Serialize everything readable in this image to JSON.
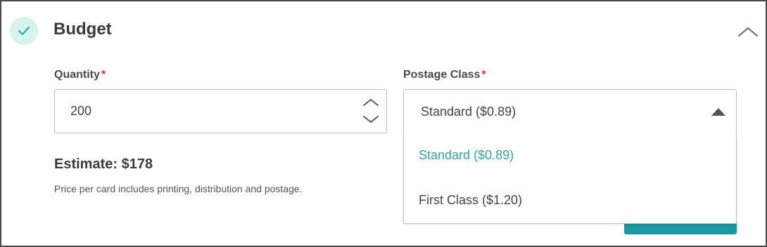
{
  "section": {
    "title": "Budget",
    "status_icon": "check-icon",
    "collapse_icon": "chevron-up-icon"
  },
  "quantity": {
    "label": "Quantity",
    "required_mark": "*",
    "value": "200",
    "stepper_up_icon": "chevron-up-icon",
    "stepper_down_icon": "chevron-down-icon"
  },
  "postage": {
    "label": "Postage Class",
    "required_mark": "*",
    "selected": "Standard ($0.89)",
    "caret_icon": "triangle-up-icon",
    "options": [
      {
        "label": "Standard ($0.89)",
        "selected": true
      },
      {
        "label": "First Class ($1.20)",
        "selected": false
      }
    ]
  },
  "estimate": {
    "text": "Estimate: $178",
    "note": "Price per card includes printing, distribution and postage."
  },
  "colors": {
    "accent": "#2fa7a5",
    "check_bg": "#d6f3ee",
    "required": "#e0304a",
    "button": "#1a9aa0"
  }
}
